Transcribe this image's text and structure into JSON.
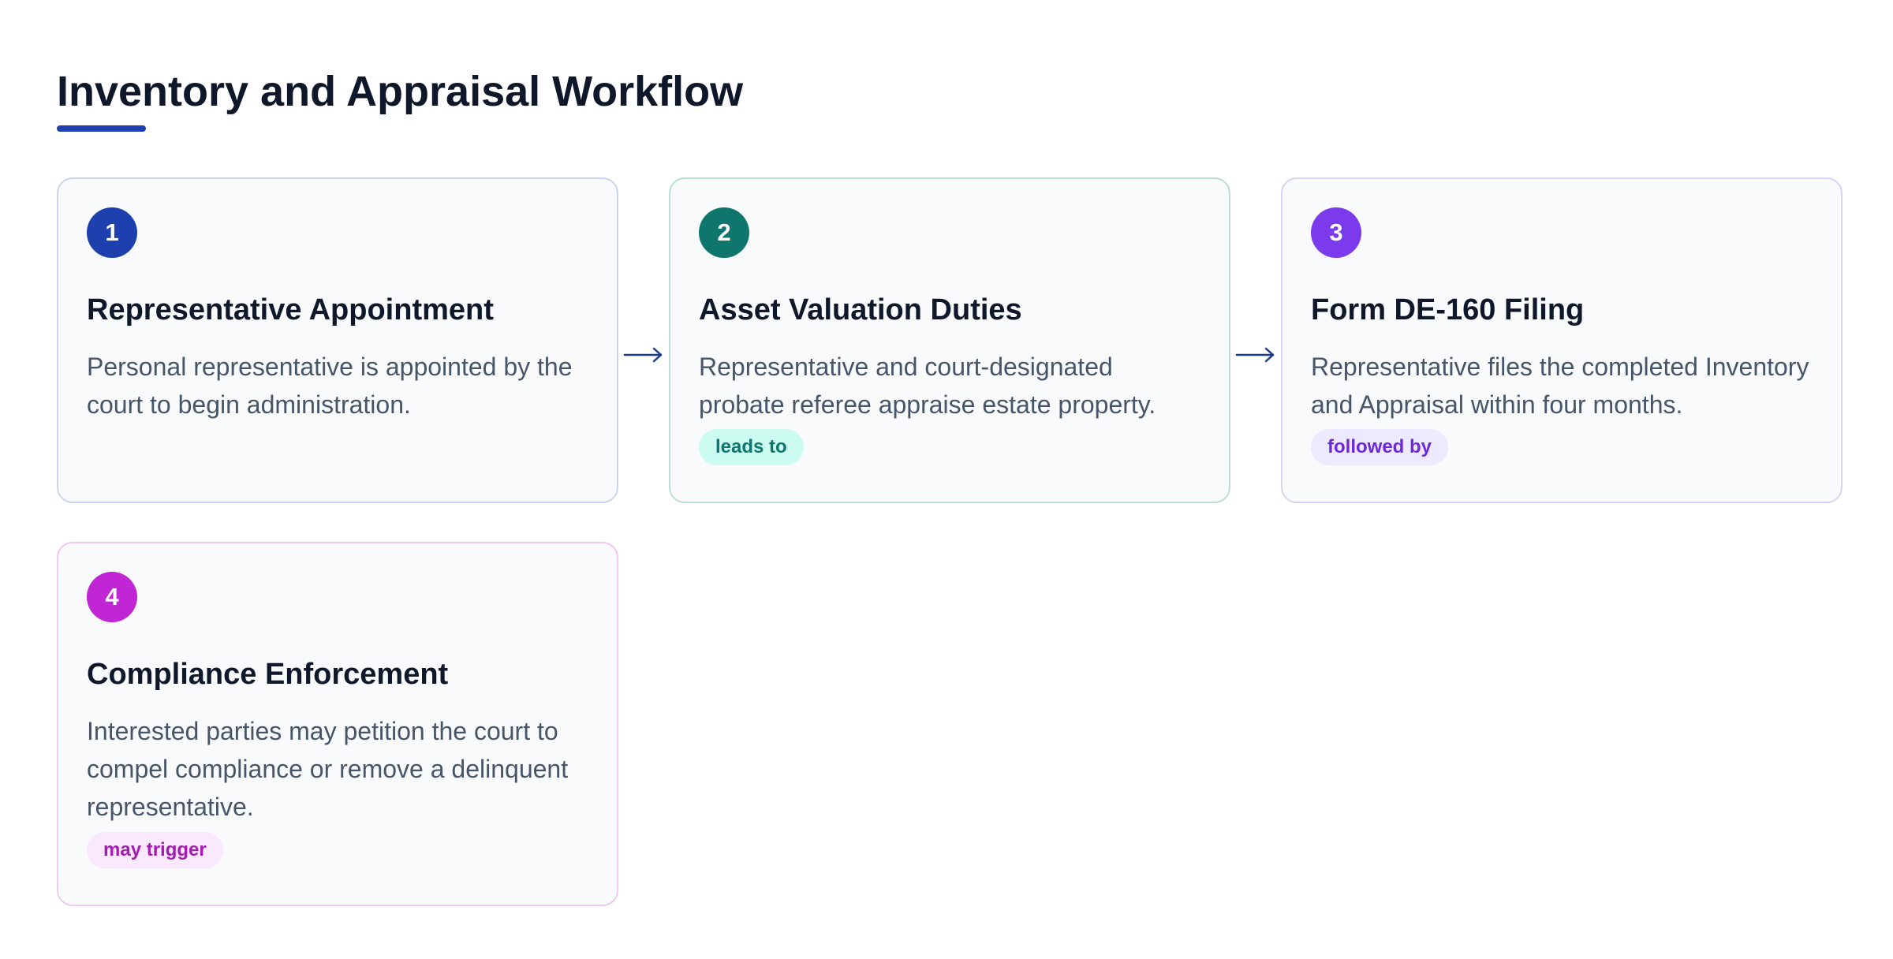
{
  "title": "Inventory and Appraisal Workflow",
  "colors": {
    "accent": "#1e40af",
    "step_1": "#1e40af",
    "step_2": "#0f766e",
    "step_3": "#7c3aed",
    "step_4": "#c026d3"
  },
  "steps": [
    {
      "number": "1",
      "title": "Representative Appointment",
      "description": "Personal representative is appointed by the court to begin administration.",
      "relation": ""
    },
    {
      "number": "2",
      "title": "Asset Valuation Duties",
      "description": "Representative and court-designated probate referee appraise estate property.",
      "relation": "leads to"
    },
    {
      "number": "3",
      "title": "Form DE-160 Filing",
      "description": "Representative files the completed Inventory and Appraisal within four months.",
      "relation": "followed by"
    },
    {
      "number": "4",
      "title": "Compliance Enforcement",
      "description": "Interested parties may petition the court to compel compliance or remove a delinquent representative.",
      "relation": "may trigger"
    }
  ],
  "connectors": {
    "icon": "arrow-right-icon",
    "color": "#1e3a8a"
  }
}
